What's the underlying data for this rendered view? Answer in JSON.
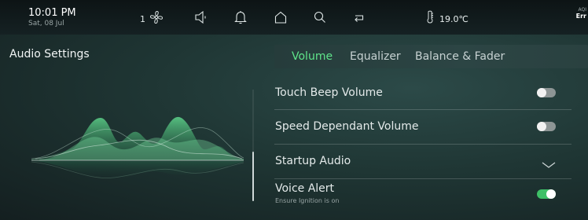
{
  "statusbar": {
    "time": "10:01 PM",
    "date": "Sat, 08 Jul",
    "fan_speed": "1",
    "temperature": "19.0℃",
    "aqi_label": "AQI",
    "aqi_value": "Err",
    "icons": [
      "fan-icon",
      "speaker-icon",
      "bell-icon",
      "home-icon",
      "search-icon",
      "return-icon",
      "thermometer-icon"
    ]
  },
  "page": {
    "title": "Audio Settings"
  },
  "tabs": [
    {
      "label": "Volume",
      "active": true
    },
    {
      "label": "Equalizer",
      "active": false
    },
    {
      "label": "Balance & Fader",
      "active": false
    }
  ],
  "settings": [
    {
      "label": "Touch Beep Volume",
      "control": "toggle",
      "state": "off"
    },
    {
      "label": "Speed Dependant Volume",
      "control": "toggle",
      "state": "off"
    },
    {
      "label": "Startup Audio",
      "control": "dropdown",
      "state": "collapsed"
    },
    {
      "label": "Voice Alert",
      "sublabel": "Ensure Ignition is on",
      "control": "toggle",
      "state": "on"
    }
  ],
  "colors": {
    "accent_active": "#5fe48a",
    "toggle_on": "#3ec067",
    "toggle_off": "#8d9595",
    "background": "#1f3634"
  }
}
